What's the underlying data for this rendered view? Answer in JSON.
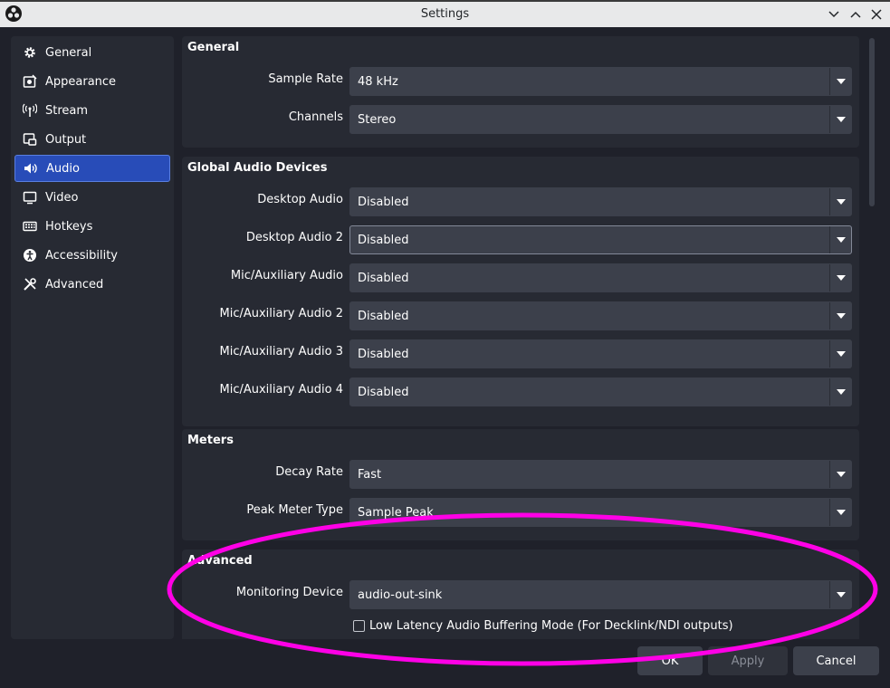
{
  "window": {
    "title": "Settings"
  },
  "sidebar": {
    "items": [
      {
        "label": "General",
        "icon": "gear-icon"
      },
      {
        "label": "Appearance",
        "icon": "appearance-icon"
      },
      {
        "label": "Stream",
        "icon": "antenna-icon"
      },
      {
        "label": "Output",
        "icon": "output-icon"
      },
      {
        "label": "Audio",
        "icon": "speaker-icon",
        "active": true
      },
      {
        "label": "Video",
        "icon": "monitor-icon"
      },
      {
        "label": "Hotkeys",
        "icon": "keyboard-icon"
      },
      {
        "label": "Accessibility",
        "icon": "accessibility-icon"
      },
      {
        "label": "Advanced",
        "icon": "tools-icon"
      }
    ]
  },
  "general": {
    "title": "General",
    "sample_rate": {
      "label": "Sample Rate",
      "value": "48 kHz"
    },
    "channels": {
      "label": "Channels",
      "value": "Stereo"
    }
  },
  "devices": {
    "title": "Global Audio Devices",
    "rows": [
      {
        "label": "Desktop Audio",
        "value": "Disabled"
      },
      {
        "label": "Desktop Audio 2",
        "value": "Disabled"
      },
      {
        "label": "Mic/Auxiliary Audio",
        "value": "Disabled"
      },
      {
        "label": "Mic/Auxiliary Audio 2",
        "value": "Disabled"
      },
      {
        "label": "Mic/Auxiliary Audio 3",
        "value": "Disabled"
      },
      {
        "label": "Mic/Auxiliary Audio 4",
        "value": "Disabled"
      }
    ]
  },
  "meters": {
    "title": "Meters",
    "decay_rate": {
      "label": "Decay Rate",
      "value": "Fast"
    },
    "peak_meter_type": {
      "label": "Peak Meter Type",
      "value": "Sample Peak"
    }
  },
  "advanced": {
    "title": "Advanced",
    "monitoring_device": {
      "label": "Monitoring Device",
      "value": "audio-out-sink"
    },
    "low_latency": {
      "label": "Low Latency Audio Buffering Mode (For Decklink/NDI outputs)",
      "checked": false
    }
  },
  "buttons": {
    "ok": "OK",
    "apply": "Apply",
    "cancel": "Cancel"
  },
  "colors": {
    "accent": "#284cb8",
    "highlight_ring": "#ff00e6",
    "panel": "#272a33",
    "background": "#1f212a"
  }
}
